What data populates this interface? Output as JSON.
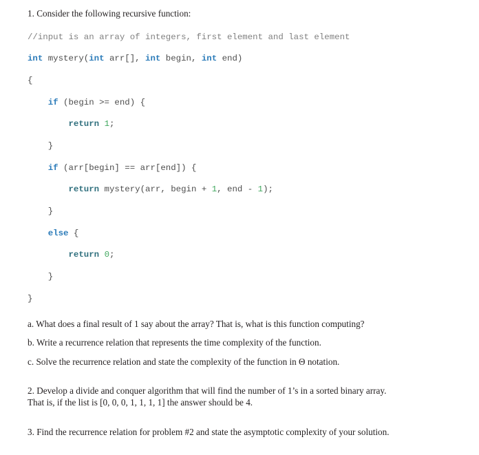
{
  "document": {
    "intro": "1. Consider the following recursive function:",
    "code": {
      "language": "c",
      "lines": [
        [
          {
            "t": "//input is an array of integers, first element and last element",
            "c": "comment"
          }
        ],
        [
          {
            "t": "int",
            "c": "kw"
          },
          {
            "t": " mystery(",
            "c": "plain"
          },
          {
            "t": "int",
            "c": "kw"
          },
          {
            "t": " arr[], ",
            "c": "plain"
          },
          {
            "t": "int",
            "c": "kw"
          },
          {
            "t": " begin, ",
            "c": "plain"
          },
          {
            "t": "int",
            "c": "kw"
          },
          {
            "t": " end)",
            "c": "plain"
          }
        ],
        [
          {
            "t": "{",
            "c": "punct"
          }
        ],
        [
          {
            "t": "    ",
            "c": "plain"
          },
          {
            "t": "if",
            "c": "kw"
          },
          {
            "t": " (begin >= end) {",
            "c": "plain"
          }
        ],
        [
          {
            "t": "        ",
            "c": "plain"
          },
          {
            "t": "return",
            "c": "return"
          },
          {
            "t": " ",
            "c": "plain"
          },
          {
            "t": "1",
            "c": "num"
          },
          {
            "t": ";",
            "c": "plain"
          }
        ],
        [
          {
            "t": "    }",
            "c": "punct"
          }
        ],
        [
          {
            "t": "    ",
            "c": "plain"
          },
          {
            "t": "if",
            "c": "kw"
          },
          {
            "t": " (arr[begin] == arr[end]) {",
            "c": "plain"
          }
        ],
        [
          {
            "t": "        ",
            "c": "plain"
          },
          {
            "t": "return",
            "c": "return"
          },
          {
            "t": " mystery(arr, begin + ",
            "c": "plain"
          },
          {
            "t": "1",
            "c": "num"
          },
          {
            "t": ", end - ",
            "c": "plain"
          },
          {
            "t": "1",
            "c": "num"
          },
          {
            "t": ");",
            "c": "plain"
          }
        ],
        [
          {
            "t": "    }",
            "c": "punct"
          }
        ],
        [
          {
            "t": "    ",
            "c": "plain"
          },
          {
            "t": "else",
            "c": "kw"
          },
          {
            "t": " {",
            "c": "plain"
          }
        ],
        [
          {
            "t": "        ",
            "c": "plain"
          },
          {
            "t": "return",
            "c": "return"
          },
          {
            "t": " ",
            "c": "plain"
          },
          {
            "t": "0",
            "c": "num"
          },
          {
            "t": ";",
            "c": "plain"
          }
        ],
        [
          {
            "t": "    }",
            "c": "punct"
          }
        ],
        [
          {
            "t": "}",
            "c": "punct"
          }
        ]
      ]
    },
    "question_1a": "a. What does a final result of 1 say about the array? That is, what is this function computing?",
    "question_1b": "b. Write a recurrence relation that represents the time complexity of the function.",
    "question_1c": "c. Solve the recurrence relation and state the complexity of the function in Θ notation.",
    "question_2_line1": "2. Develop a divide and conquer algorithm that will find the number of 1’s in a sorted binary array.",
    "question_2_line2": "That is, if the list is [0, 0, 0, 1, 1, 1, 1] the answer should be 4.",
    "question_3": "3. Find the recurrence relation for problem #2 and state the asymptotic complexity of your solution."
  },
  "colors": {
    "background": "#ffffff",
    "body_text": "#231f20",
    "code_text": "#4d4d4d",
    "comment": "#808080",
    "keyword": "#2b7bb9",
    "return_keyword": "#2f6f7d",
    "number_literal": "#41a85f"
  }
}
